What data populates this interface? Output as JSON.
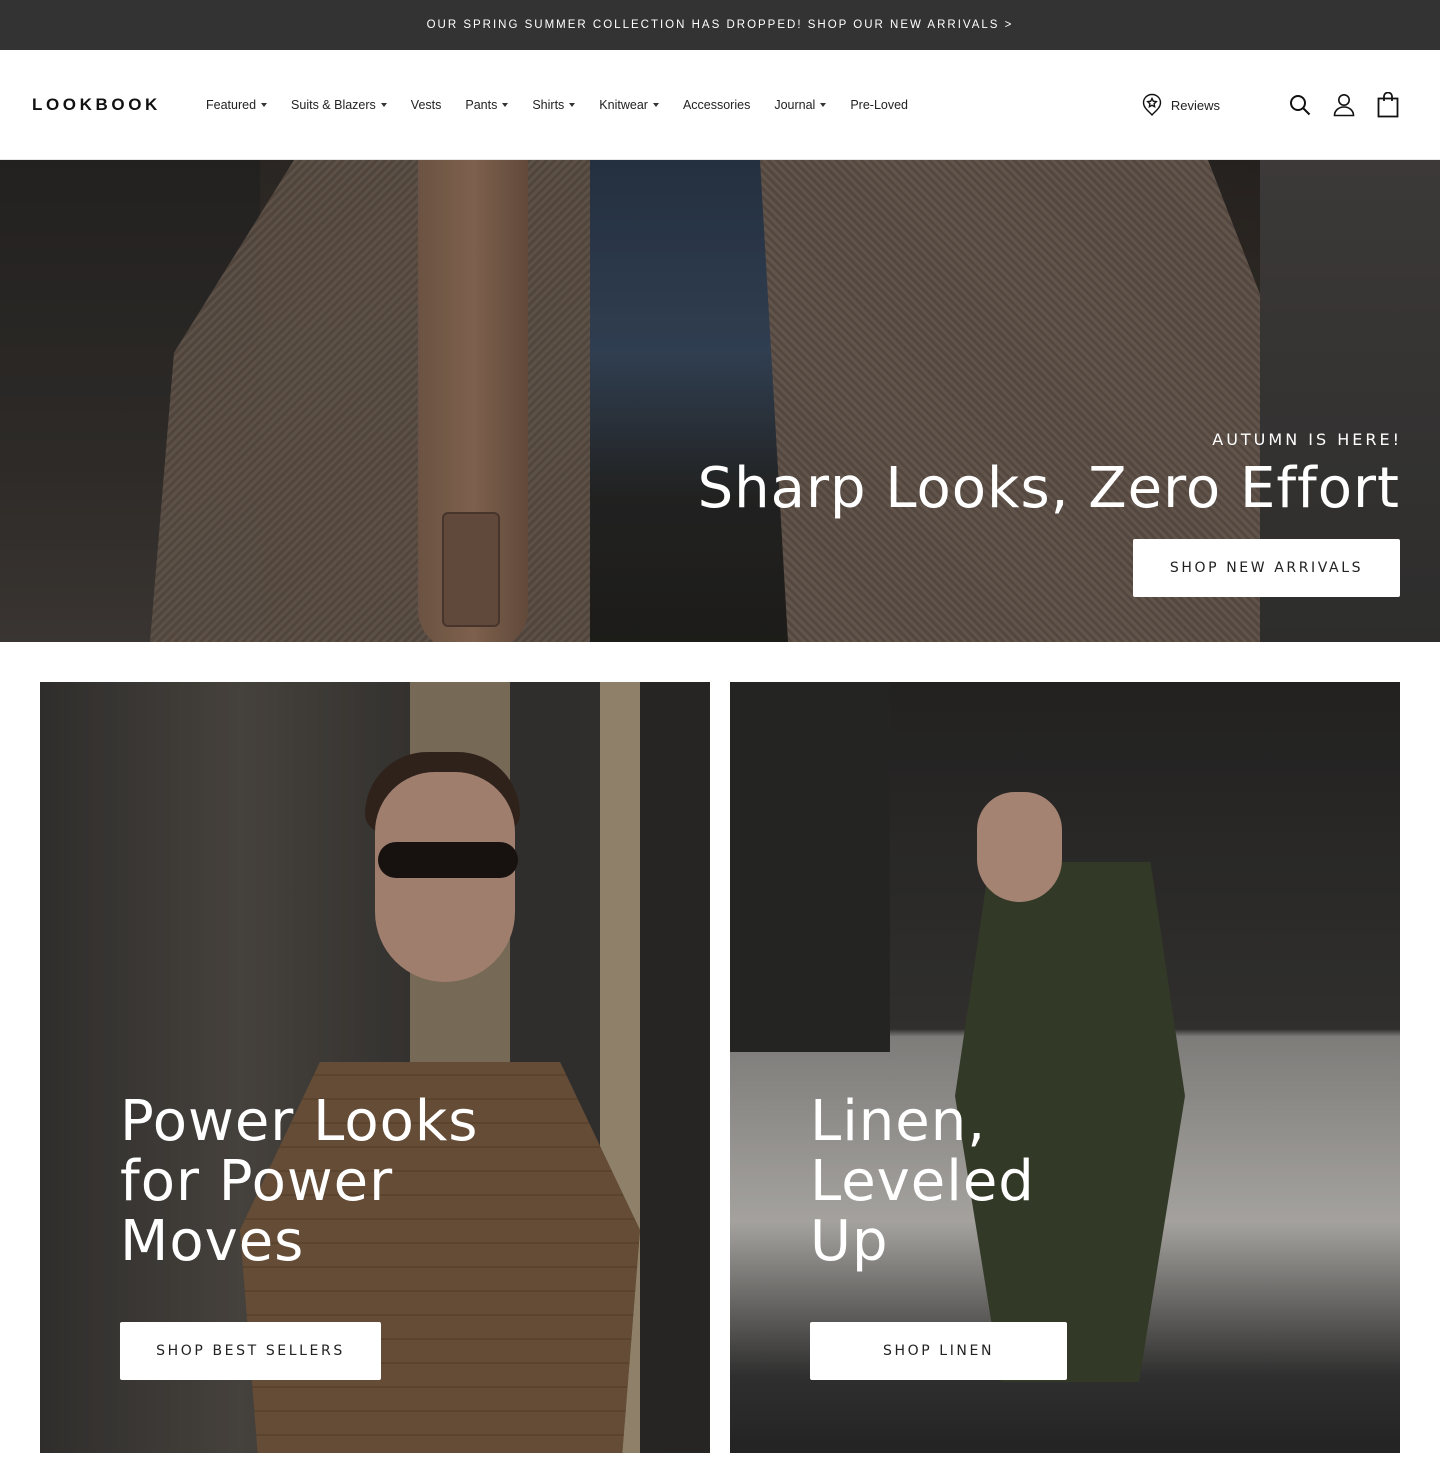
{
  "announcement": {
    "text": "OUR SPRING SUMMER COLLECTION HAS DROPPED! SHOP OUR NEW ARRIVALS >"
  },
  "header": {
    "logo": "LOOKBOOK",
    "nav": [
      {
        "label": "Featured",
        "has_dropdown": true
      },
      {
        "label": "Suits & Blazers",
        "has_dropdown": true
      },
      {
        "label": "Vests",
        "has_dropdown": false
      },
      {
        "label": "Pants",
        "has_dropdown": true
      },
      {
        "label": "Shirts",
        "has_dropdown": true
      },
      {
        "label": "Knitwear",
        "has_dropdown": true
      },
      {
        "label": "Accessories",
        "has_dropdown": false
      },
      {
        "label": "Journal",
        "has_dropdown": true
      },
      {
        "label": "Pre-Loved",
        "has_dropdown": false
      }
    ],
    "reviews_label": "Reviews",
    "icons": [
      "star-badge-icon",
      "search-icon",
      "account-icon",
      "cart-icon"
    ]
  },
  "hero": {
    "eyebrow": "AUTUMN IS HERE!",
    "title": "Sharp Looks, Zero Effort",
    "button_label": "SHOP NEW ARRIVALS"
  },
  "promos": [
    {
      "title": "Power Looks for Power Moves",
      "button_label": "SHOP BEST SELLERS"
    },
    {
      "title": "Linen, Leveled Up",
      "button_label": "SHOP LINEN"
    }
  ],
  "colors": {
    "announcement_bg": "#333333",
    "button_bg": "#ffffff",
    "text_light": "#ffffff"
  }
}
